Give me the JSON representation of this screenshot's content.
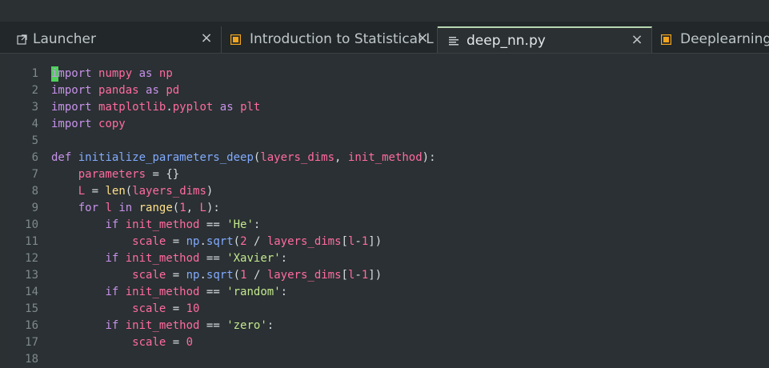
{
  "tabs": [
    {
      "label": "Launcher",
      "icon": "external-link-icon",
      "close": "×",
      "active": false
    },
    {
      "label": "Introduction to Statistical L",
      "icon": "notebook-icon",
      "close": "×",
      "active": false
    },
    {
      "label": "deep_nn.py",
      "icon": "file-text-icon",
      "close": "×",
      "active": true
    },
    {
      "label": "Deeplearning_",
      "icon": "notebook-icon",
      "close": "",
      "active": false
    }
  ],
  "editor": {
    "line_numbers": [
      "1",
      "2",
      "3",
      "4",
      "5",
      "6",
      "7",
      "8",
      "9",
      "10",
      "11",
      "12",
      "13",
      "14",
      "15",
      "16",
      "17",
      "18"
    ],
    "lines": [
      "import numpy as np",
      "import pandas as pd",
      "import matplotlib.pyplot as plt",
      "import copy",
      "",
      "def initialize_parameters_deep(layers_dims, init_method):",
      "    parameters = {}",
      "    L = len(layers_dims)",
      "    for l in range(1, L):",
      "        if init_method == 'He':",
      "            scale = np.sqrt(2 / layers_dims[l-1])",
      "        if init_method == 'Xavier':",
      "            scale = np.sqrt(1 / layers_dims[l-1])",
      "        if init_method == 'random':",
      "            scale = 10",
      "        if init_method == 'zero':",
      "            scale = 0",
      ""
    ]
  },
  "colors": {
    "accent": "#b7d7b1",
    "cursor": "#4fd15b",
    "keyword": "#c792ea",
    "function": "#82aaff",
    "variable": "#ff6b9f",
    "string": "#c3e88d",
    "builtin": "#ffe08a"
  }
}
